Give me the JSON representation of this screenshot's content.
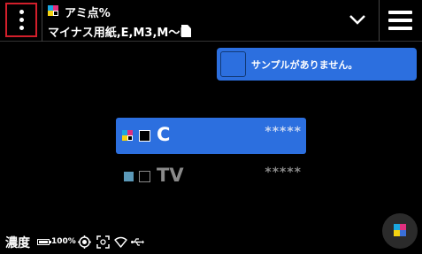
{
  "header": {
    "menu_icon": "kebab-menu-icon",
    "title": "アミ点%",
    "subtitle": "マイナス用紙,E,M3,M〜D",
    "subtitle_icon": "document-icon",
    "expand_icon": "chevron-down-icon",
    "hamburger_icon": "hamburger-menu-icon"
  },
  "sample": {
    "message": "サンプルがありません。",
    "color": "#2c6fdf"
  },
  "list": {
    "rows": [
      {
        "name": "C",
        "rating": "*****",
        "selected": true
      },
      {
        "name": "TV",
        "rating": "*****",
        "selected": false
      }
    ]
  },
  "status": {
    "density_label": "濃度",
    "battery_pct": "100%",
    "icons": [
      "target-icon",
      "focus-icon",
      "wifi-icon",
      "usb-icon"
    ]
  },
  "colors": {
    "accent": "#2c6fdf",
    "highlight_border": "#d21f2b",
    "cyan": "#1aa7e0",
    "magenta": "#e0307f",
    "yellow": "#f5d311"
  }
}
